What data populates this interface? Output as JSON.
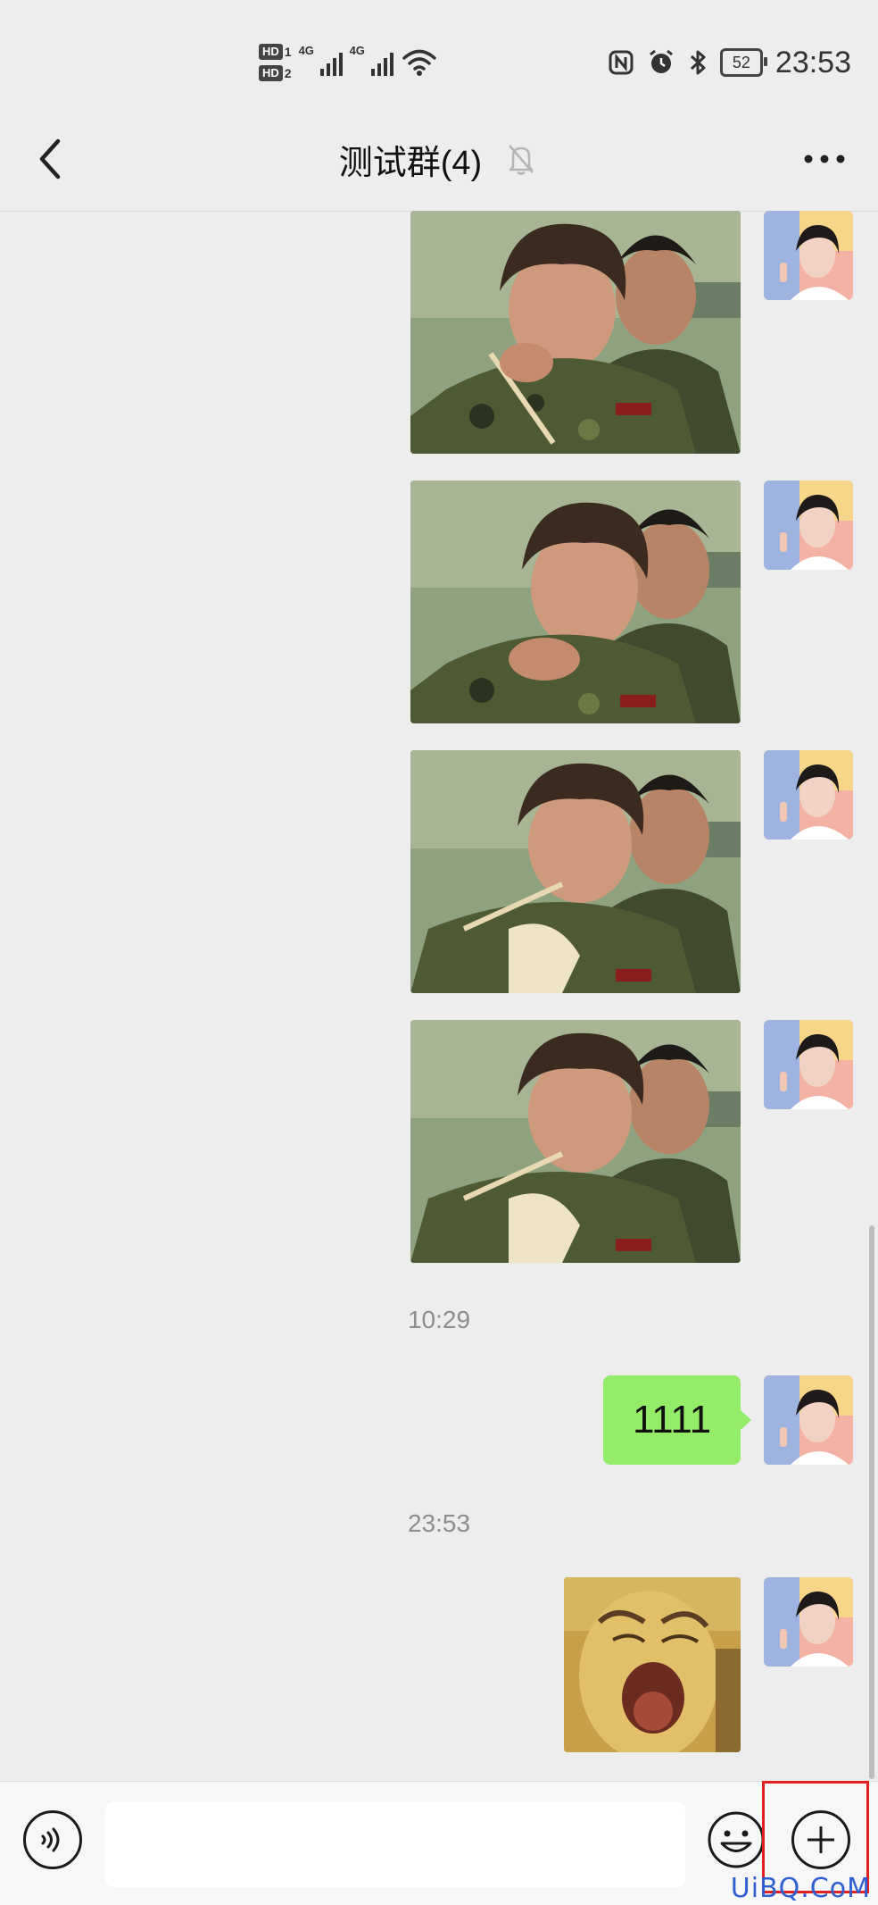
{
  "status_bar": {
    "sim1": "HD",
    "sim1_num": "1",
    "sim2": "HD",
    "sim2_num": "2",
    "net1": "4G",
    "net2": "4G",
    "battery": "52",
    "time": "23:53"
  },
  "header": {
    "title": "测试群(4)",
    "icons": [
      "back-icon",
      "mute-bell-icon",
      "more-icon"
    ]
  },
  "messages": [
    {
      "type": "image",
      "sender": "self"
    },
    {
      "type": "image",
      "sender": "self"
    },
    {
      "type": "image",
      "sender": "self"
    },
    {
      "type": "image",
      "sender": "self"
    },
    {
      "type": "timestamp",
      "text": "10:29"
    },
    {
      "type": "text",
      "sender": "self",
      "text": "1111"
    },
    {
      "type": "timestamp",
      "text": "23:53"
    },
    {
      "type": "sticker",
      "sender": "self"
    }
  ],
  "input_bar": {
    "text_value": "",
    "icons": [
      "voice-icon",
      "emoji-icon",
      "plus-icon"
    ]
  },
  "watermark": "UiBQ.CoM",
  "colors": {
    "background": "#ededed",
    "bubble_self": "#95ec69",
    "highlight": "#e02020"
  }
}
